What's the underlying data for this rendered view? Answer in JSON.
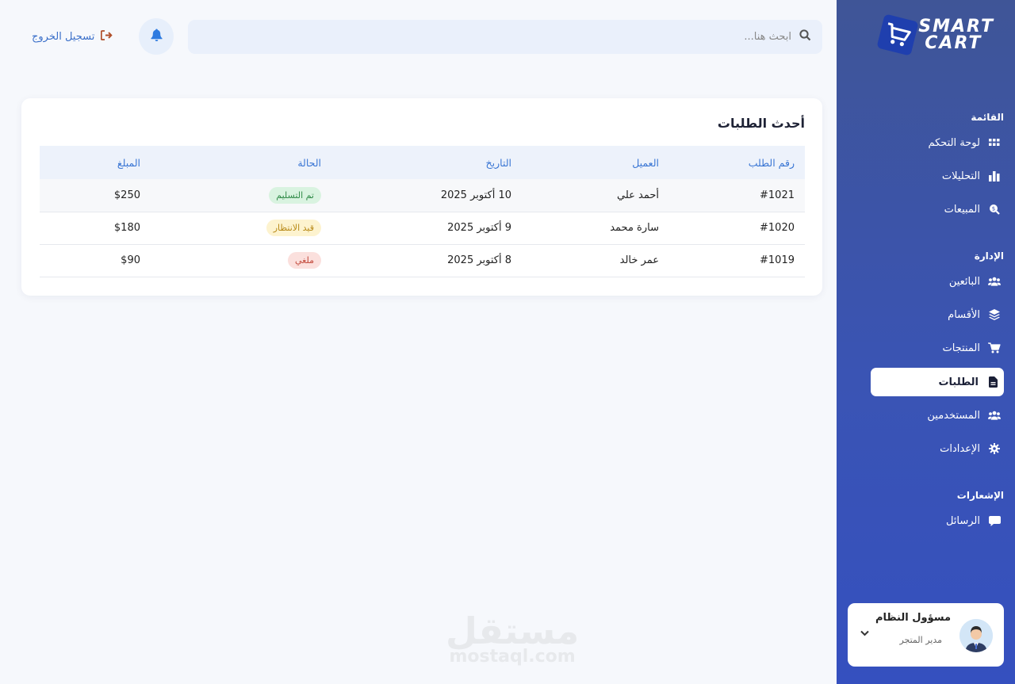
{
  "brand": {
    "line1": "SMART",
    "line2": "CART"
  },
  "sidebar": {
    "sections": [
      {
        "title": "القائمة"
      },
      {
        "title": "الإدارة"
      },
      {
        "title": "الإشعارات"
      }
    ],
    "items": [
      {
        "label": "لوحة التحكم",
        "icon": "grid-icon"
      },
      {
        "label": "التحليلات",
        "icon": "bar-chart-icon"
      },
      {
        "label": "المبيعات",
        "icon": "search-dollar-icon"
      },
      {
        "label": "البائعين",
        "icon": "users-icon"
      },
      {
        "label": "الأقسام",
        "icon": "layers-icon"
      },
      {
        "label": "المنتجات",
        "icon": "cart-icon"
      },
      {
        "label": "الطلبات",
        "icon": "file-icon",
        "active": true
      },
      {
        "label": "المستخدمين",
        "icon": "users-icon"
      },
      {
        "label": "الإعدادات",
        "icon": "gear-icon"
      },
      {
        "label": "الرسائل",
        "icon": "message-icon"
      }
    ]
  },
  "user": {
    "name": "مسؤول النظام",
    "role": "مدير المتجر"
  },
  "topbar": {
    "search_placeholder": "ابحث هنا...",
    "logout_label": "تسجيل الخروج"
  },
  "orders": {
    "title": "أحدث الطلبات",
    "columns": [
      "رقم الطلب",
      "العميل",
      "التاريخ",
      "الحالة",
      "المبلغ"
    ],
    "rows": [
      {
        "id": "#1021",
        "customer": "أحمد علي",
        "date": "10 أكتوبر 2025",
        "status": "تم التسليم",
        "status_type": "green",
        "amount": "$250"
      },
      {
        "id": "#1020",
        "customer": "سارة محمد",
        "date": "9 أكتوبر 2025",
        "status": "قيد الانتظار",
        "status_type": "yellow",
        "amount": "$180"
      },
      {
        "id": "#1019",
        "customer": "عمر خالد",
        "date": "8 أكتوبر 2025",
        "status": "ملغي",
        "status_type": "red",
        "amount": "$90"
      }
    ]
  },
  "watermark": {
    "ar": "مستقل",
    "en": "mostaql.com"
  },
  "colors": {
    "accent": "#3a76d4",
    "sidebar": "#3a54b4",
    "success": "#2f8a47",
    "warning": "#b88917",
    "danger": "#c2483a"
  }
}
